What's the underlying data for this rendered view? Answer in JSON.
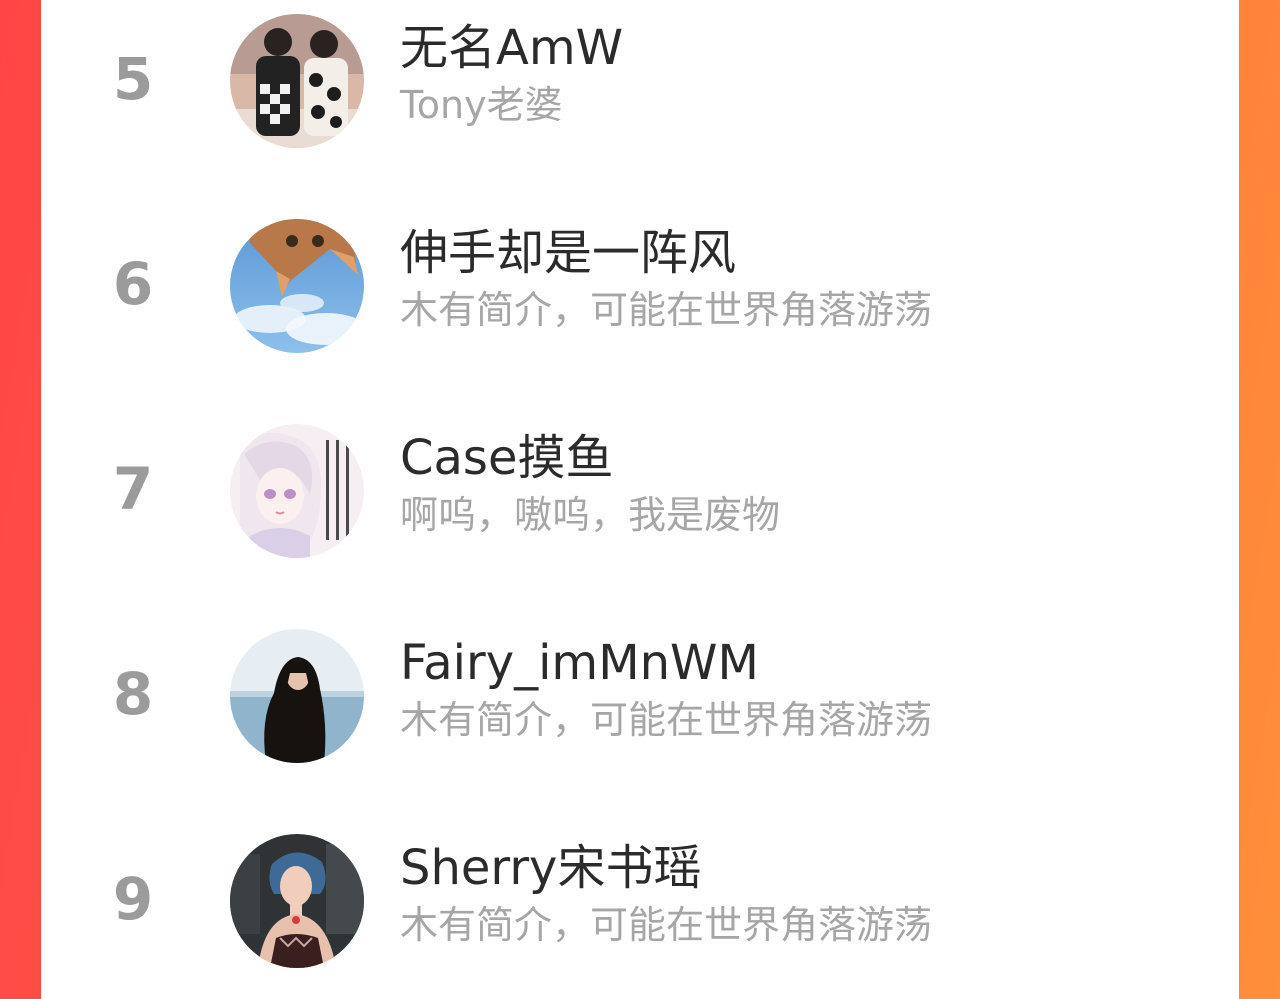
{
  "colors": {
    "rank": "#9b9b9b",
    "name": "#2b2b2b",
    "bio": "#a6a6a6",
    "card": "#ffffff",
    "frame_left": "#ff4646",
    "frame_right": "#ff8f3a"
  },
  "users": [
    {
      "rank": "5",
      "name": "无名AmW",
      "bio": "Tony老婆",
      "avatar": "avatar-photo-two-girls"
    },
    {
      "rank": "6",
      "name": "伸手却是一阵风",
      "bio": "木有简介，可能在世界角落游荡",
      "avatar": "avatar-photo-cat-sky"
    },
    {
      "rank": "7",
      "name": "Case摸鱼",
      "bio": "啊呜，嗷呜，我是废物",
      "avatar": "avatar-illustration-anime-girl"
    },
    {
      "rank": "8",
      "name": "Fairy_imMnWM",
      "bio": "木有简介，可能在世界角落游荡",
      "avatar": "avatar-photo-woman-sea"
    },
    {
      "rank": "9",
      "name": "Sherry宋书瑶",
      "bio": "木有简介，可能在世界角落游荡",
      "avatar": "avatar-photo-woman-blue-hair"
    }
  ]
}
